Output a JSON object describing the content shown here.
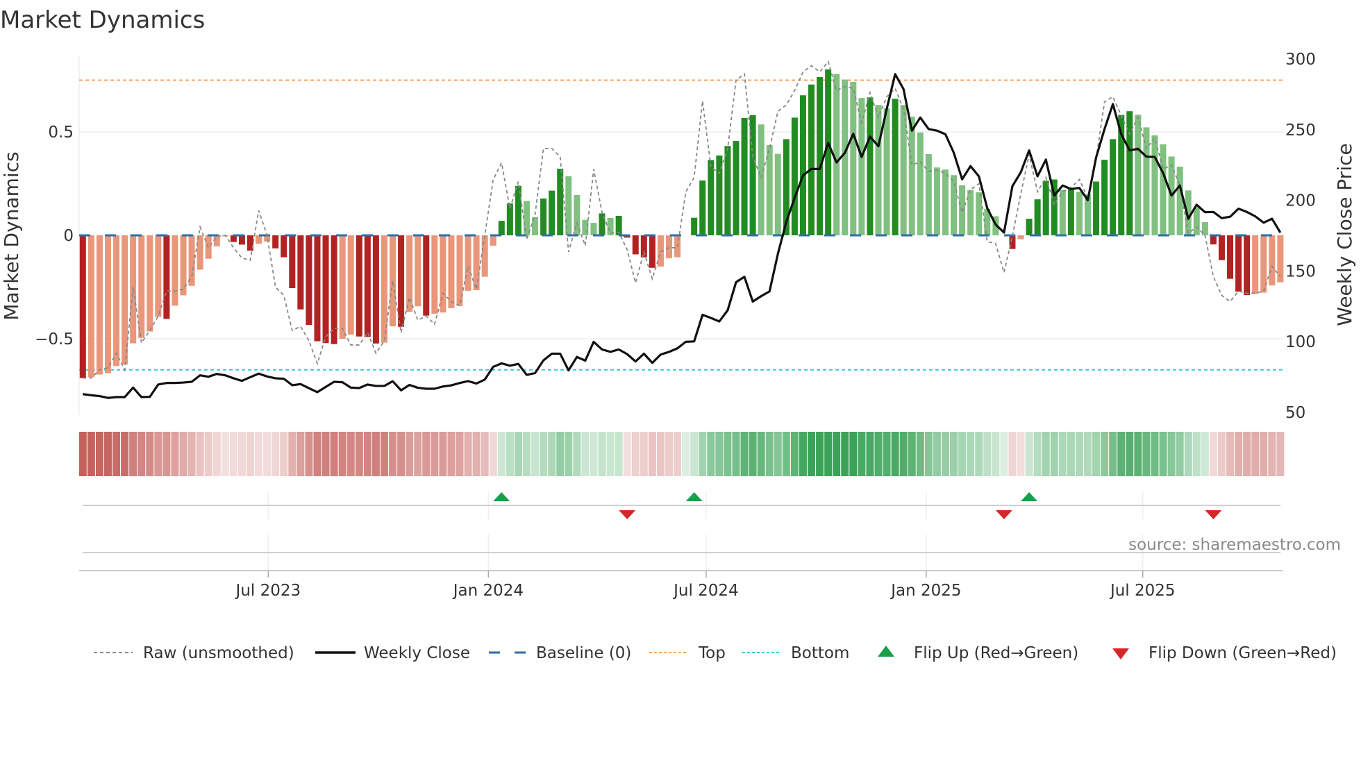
{
  "chart_data": {
    "type": "bar",
    "title": "Market Dynamics",
    "ylabel_left": "Market Dynamics",
    "ylabel_right": "Weekly Close Price",
    "start_date": "2023-01-27",
    "interval_days": 7,
    "ylim_left": [
      -0.78,
      0.9
    ],
    "ylim_right": [
      50,
      300
    ],
    "left_ticks": [
      {
        "value": 0.5,
        "label": "0.5"
      },
      {
        "value": 0,
        "label": "0"
      },
      {
        "value": -0.5,
        "label": "−0.5"
      }
    ],
    "right_ticks": [
      {
        "value": 300,
        "label": "300"
      },
      {
        "value": 250,
        "label": "250"
      },
      {
        "value": 200,
        "label": "200"
      },
      {
        "value": 150,
        "label": "150"
      },
      {
        "value": 100,
        "label": "100"
      },
      {
        "value": 50,
        "label": "50"
      }
    ],
    "x_ticks": [
      {
        "date": "2023-07-01",
        "label": "Jul 2023"
      },
      {
        "date": "2024-01-01",
        "label": "Jan 2024"
      },
      {
        "date": "2024-07-01",
        "label": "Jul 2024"
      },
      {
        "date": "2025-01-01",
        "label": "Jan 2025"
      },
      {
        "date": "2025-07-01",
        "label": "Jul 2025"
      }
    ],
    "top_level": 0.75,
    "bottom_level": -0.65,
    "baseline": 0,
    "smoothed": [
      -0.69,
      -0.686,
      -0.673,
      -0.666,
      -0.632,
      -0.624,
      -0.522,
      -0.496,
      -0.465,
      -0.394,
      -0.404,
      -0.34,
      -0.29,
      -0.244,
      -0.166,
      -0.113,
      -0.053,
      -0.005,
      -0.032,
      -0.045,
      -0.074,
      -0.04,
      -0.03,
      -0.063,
      -0.106,
      -0.255,
      -0.358,
      -0.433,
      -0.512,
      -0.521,
      -0.526,
      -0.5,
      -0.48,
      -0.489,
      -0.491,
      -0.523,
      -0.519,
      -0.44,
      -0.442,
      -0.37,
      -0.343,
      -0.388,
      -0.379,
      -0.373,
      -0.352,
      -0.341,
      -0.268,
      -0.265,
      -0.2,
      -0.05,
      0.07,
      0.154,
      0.239,
      0.166,
      0.088,
      0.178,
      0.216,
      0.322,
      0.286,
      0.195,
      0.075,
      0.06,
      0.106,
      0.084,
      0.094,
      -0.011,
      -0.092,
      -0.106,
      -0.157,
      -0.151,
      -0.111,
      -0.106,
      0,
      0.085,
      0.265,
      0.364,
      0.386,
      0.432,
      0.456,
      0.567,
      0.581,
      0.536,
      0.436,
      0.394,
      0.465,
      0.569,
      0.677,
      0.729,
      0.765,
      0.802,
      0.78,
      0.753,
      0.742,
      0.664,
      0.667,
      0.63,
      0.614,
      0.66,
      0.63,
      0.573,
      0.497,
      0.393,
      0.328,
      0.318,
      0.291,
      0.242,
      0.219,
      0.208,
      0.128,
      0.092,
      0,
      -0.066,
      -0.019,
      0.08,
      0.174,
      0.263,
      0.27,
      0.22,
      0.224,
      0.21,
      0.198,
      0.26,
      0.365,
      0.465,
      0.582,
      0.6,
      0.583,
      0.522,
      0.483,
      0.44,
      0.381,
      0.332,
      0.217,
      0.135,
      0.064,
      -0.044,
      -0.12,
      -0.21,
      -0.272,
      -0.289,
      -0.283,
      -0.277,
      -0.242,
      -0.227
    ],
    "raw": [
      -0.69,
      -0.69,
      -0.65,
      -0.64,
      -0.57,
      -0.65,
      -0.25,
      -0.52,
      -0.46,
      -0.39,
      -0.27,
      -0.27,
      -0.26,
      -0.2,
      0.04,
      -0.06,
      -0.005,
      0,
      -0.06,
      -0.11,
      -0.12,
      0.12,
      0,
      -0.25,
      -0.29,
      -0.46,
      -0.44,
      -0.51,
      -0.62,
      -0.49,
      -0.45,
      -0.45,
      -0.53,
      -0.53,
      -0.47,
      -0.57,
      -0.51,
      -0.22,
      -0.47,
      -0.3,
      -0.41,
      -0.39,
      -0.43,
      -0.28,
      -0.32,
      -0.34,
      -0.15,
      -0.26,
      0,
      0.27,
      0.35,
      0.13,
      0.26,
      -0.02,
      0.1,
      0.42,
      0.42,
      0.38,
      -0.08,
      0.06,
      -0.05,
      0.32,
      0.11,
      0.01,
      0.015,
      -0.07,
      -0.23,
      -0.08,
      -0.21,
      -0.08,
      -0.06,
      -0.06,
      0.21,
      0.28,
      0.65,
      0.33,
      0.3,
      0.42,
      0.75,
      0.78,
      0.38,
      0.28,
      0.42,
      0.6,
      0.63,
      0.7,
      0.79,
      0.82,
      0.79,
      0.84,
      0.7,
      0.72,
      0.71,
      0.545,
      0.69,
      0.57,
      0.67,
      0.71,
      0.61,
      0.34,
      0.355,
      0.31,
      0.315,
      0.3,
      0.26,
      0.11,
      0.22,
      0.25,
      -0.03,
      -0.04,
      -0.18,
      -0.004,
      0.2,
      0.39,
      0.21,
      0.28,
      0.15,
      0.21,
      0.23,
      0.27,
      0.18,
      0.37,
      0.645,
      0.67,
      0.58,
      0.49,
      0.57,
      0.42,
      0.47,
      0.32,
      0.34,
      0.24,
      0.01,
      0.04,
      0,
      -0.2,
      -0.29,
      -0.32,
      -0.27,
      -0.28,
      -0.28,
      -0.27,
      -0.15,
      -0.2
    ],
    "weekly_close": [
      62.9,
      62.1,
      61.5,
      60.2,
      60.8,
      60.8,
      67.5,
      60.8,
      61,
      69.7,
      70.8,
      70.8,
      71.1,
      71.6,
      76.2,
      75.2,
      77.2,
      76.2,
      74.1,
      72.3,
      74.9,
      77.4,
      75.4,
      74.1,
      73.8,
      69.2,
      70,
      67.1,
      64.3,
      68,
      71.6,
      71.3,
      67.5,
      67.2,
      69.7,
      68.7,
      68.7,
      72,
      65.6,
      69.4,
      67.4,
      66.7,
      66.7,
      68.3,
      69.1,
      70.8,
      72.1,
      70.4,
      73.2,
      82.2,
      84.7,
      83,
      84.3,
      76.5,
      77.8,
      86.8,
      91.5,
      91.5,
      79.7,
      89.2,
      86.6,
      99.9,
      94.5,
      92.8,
      94.5,
      91.2,
      86,
      91.5,
      85,
      90.9,
      92.8,
      95.3,
      99.9,
      100.2,
      119,
      116.8,
      114.3,
      122.2,
      142.1,
      145.9,
      128.4,
      132.2,
      135.6,
      162.2,
      184.8,
      201.7,
      217.7,
      222.2,
      222.2,
      240.6,
      226.8,
      233.7,
      247.1,
      230.7,
      245.1,
      238.3,
      264.8,
      289.3,
      278.7,
      249.3,
      258.6,
      250.4,
      249.3,
      246.8,
      233.7,
      214.9,
      224.2,
      217,
      194.4,
      182.9,
      177.2,
      210,
      219.8,
      235.3,
      217,
      228.8,
      203.4,
      210.5,
      208,
      208.8,
      200.1,
      230.4,
      250.4,
      268.1,
      246.8,
      235.3,
      236.5,
      230.9,
      230.7,
      219.3,
      203.4,
      210.5,
      187,
      196.9,
      191.6,
      191.8,
      187.4,
      188.4,
      194.1,
      191.8,
      188.7,
      184.2,
      187,
      177.2
    ],
    "flips": [
      {
        "type": "up",
        "date": "2024-01-12"
      },
      {
        "type": "down",
        "date": "2024-04-26"
      },
      {
        "type": "up",
        "date": "2024-06-21"
      },
      {
        "type": "down",
        "date": "2025-03-07"
      },
      {
        "type": "up",
        "date": "2025-03-28"
      },
      {
        "type": "down",
        "date": "2025-08-29"
      }
    ],
    "legend": {
      "position": "bottom",
      "items": [
        {
          "key": "raw",
          "label": "Raw (unsmoothed)"
        },
        {
          "key": "close",
          "label": "Weekly Close"
        },
        {
          "key": "baseline",
          "label": "Baseline (0)"
        },
        {
          "key": "top",
          "label": "Top"
        },
        {
          "key": "bottom",
          "label": "Bottom"
        },
        {
          "key": "flip_up",
          "label": "Flip Up (Red→Green)"
        },
        {
          "key": "flip_down",
          "label": "Flip Down (Green→Red)"
        }
      ]
    },
    "source": "source: sharemaestro.com",
    "colors": {
      "pos_strong": "#228b22",
      "pos_weak": "#80c080",
      "neg_strong": "#b22222",
      "neg_weak": "#e9967a",
      "raw": "#888888",
      "close": "#111111",
      "baseline": "#2e6fa7",
      "top": "#f4a460",
      "bottom": "#3fc7d6",
      "flip_up": "#1a9e4a",
      "flip_down": "#d62728",
      "heat_pos": "#3aa357",
      "heat_neg": "#c25a55",
      "grid": "#eceef2",
      "axis": "#cccccc"
    }
  }
}
